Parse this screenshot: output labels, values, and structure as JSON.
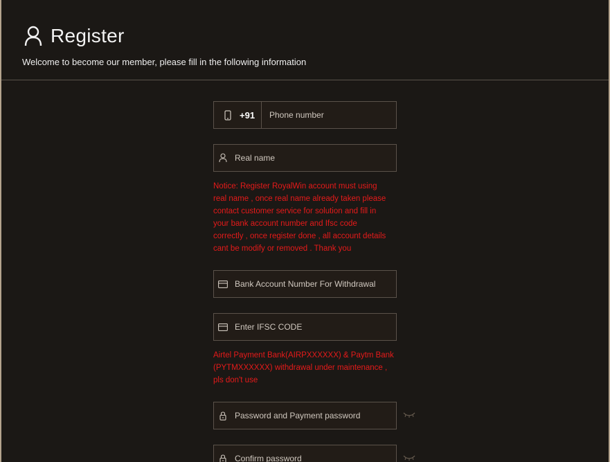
{
  "header": {
    "title": "Register",
    "subtitle": "Welcome to become our member, please fill in the following information",
    "icon": "user-icon"
  },
  "form": {
    "phone": {
      "country_code": "+91",
      "placeholder": "Phone number",
      "icon": "mobile-phone-icon"
    },
    "real_name": {
      "placeholder": "Real name",
      "icon": "user-icon"
    },
    "notice_real_name": [
      "Notice: Register RoyalWin account must using",
      "real name , once real name already taken please",
      "contact customer service for solution and fill in",
      "your bank account number and Ifsc code",
      "correctly , once register done , all account details",
      "cant be modify or removed . Thank you"
    ],
    "bank_account": {
      "placeholder": "Bank Account Number For Withdrawal",
      "icon": "card-icon"
    },
    "ifsc": {
      "placeholder": "Enter IFSC CODE",
      "icon": "card-icon"
    },
    "notice_maintenance": [
      "Airtel Payment Bank(AIRPXXXXXX) & Paytm Bank",
      "(PYTMXXXXXX) withdrawal under maintenance ,",
      "pls don't use"
    ],
    "password": {
      "placeholder": "Password and Payment password",
      "icon": "lock-icon",
      "toggle_icon": "eye-closed-icon"
    },
    "confirm_password": {
      "placeholder": "Confirm password",
      "icon": "lock-icon",
      "toggle_icon": "eye-closed-icon"
    }
  },
  "colors": {
    "background": "#1b1815",
    "field_background": "#221c17",
    "field_border": "#5b524a",
    "notice_text": "#e61a1a",
    "title_text": "#f2f2f2"
  }
}
